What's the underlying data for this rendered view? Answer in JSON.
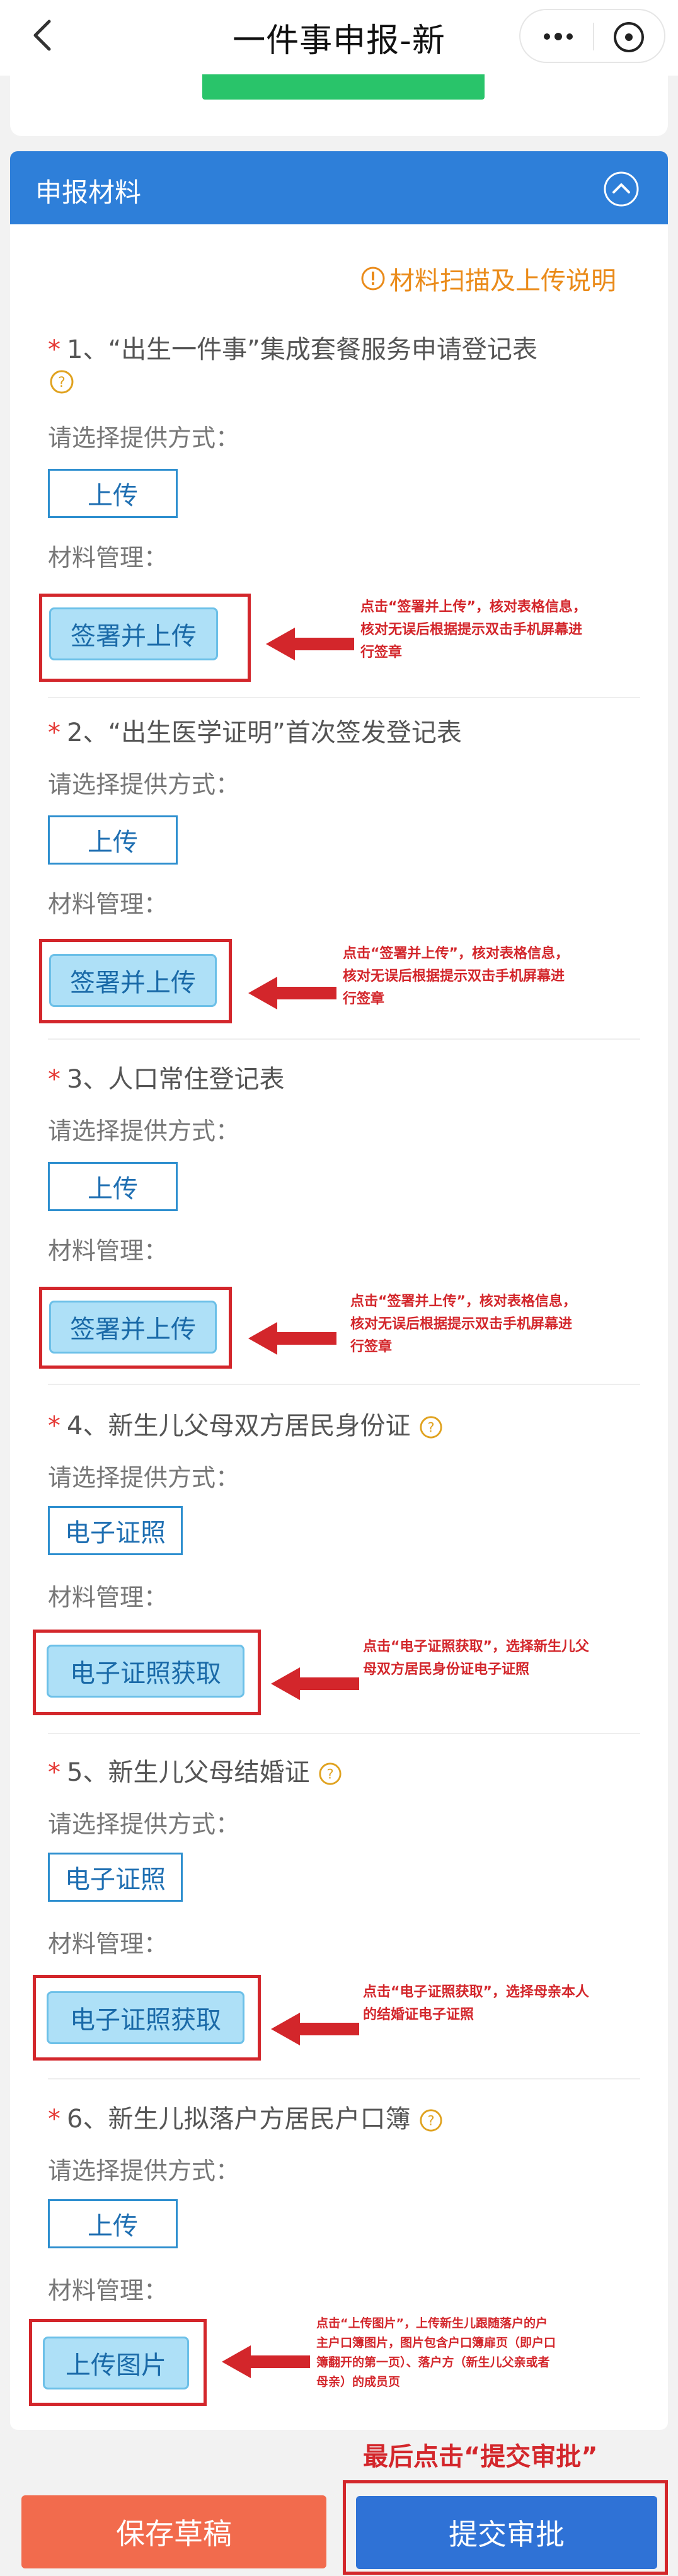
{
  "header": {
    "title": "一件事申报-新",
    "icons": [
      "back-icon",
      "more-icon",
      "close-icon"
    ]
  },
  "section": {
    "title": "申报材料",
    "help_link": "材料扫描及上传说明"
  },
  "labels": {
    "provide_method": "请选择提供方式：",
    "material_manage": "材料管理："
  },
  "items": [
    {
      "number": "1、“出生一件事”集成套餐服务申请登记表",
      "required": "*",
      "method": "上传",
      "action": "签署并上传",
      "note": "点击“签署并上传”，核对表格信息，核对无误后根据提示双击手机屏幕进行签章"
    },
    {
      "number": "2、“出生医学证明”首次签发登记表",
      "required": "*",
      "method": "上传",
      "action": "签署并上传",
      "note": "点击“签署并上传”，核对表格信息，核对无误后根据提示双击手机屏幕进行签章"
    },
    {
      "number": "3、人口常住登记表",
      "required": "*",
      "method": "上传",
      "action": "签署并上传",
      "note": "点击“签署并上传”，核对表格信息，核对无误后根据提示双击手机屏幕进行签章"
    },
    {
      "number": "4、新生儿父母双方居民身份证",
      "required": "*",
      "method": "电子证照",
      "action": "电子证照获取",
      "note": "点击“电子证照获取”，选择新生儿父母双方居民身份证电子证照"
    },
    {
      "number": "5、新生儿父母结婚证",
      "required": "*",
      "method": "电子证照",
      "action": "电子证照获取",
      "note": "点击“电子证照获取”，选择母亲本人的结婚证电子证照"
    },
    {
      "number": "6、新生儿拟落户方居民户口簿",
      "required": "*",
      "method": "上传",
      "action": "上传图片",
      "note": "点击“上传图片”，上传新生儿跟随落户的户主户口簿图片，图片包含户口簿扉页（即户口簿翻开的第一页）、落户方（新生儿父亲或者母亲）的成员页"
    }
  ],
  "footer": {
    "final_tip": "最后点击“提交审批”",
    "save_label": "保存草稿",
    "submit_label": "提交审批"
  },
  "colors": {
    "header_blue": "#2e7fd9",
    "required_red": "#e53935",
    "help_orange": "#ea8b1a",
    "annotation_red": "#d3262b",
    "save_orange": "#f26b4d",
    "submit_blue": "#2f72d6",
    "action_button_bg": "#aee0f7"
  }
}
